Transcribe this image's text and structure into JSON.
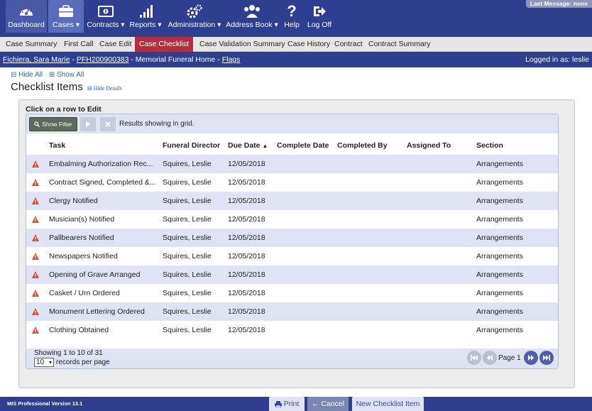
{
  "nav": {
    "items": [
      {
        "label": "Dashboard",
        "icon": "dashboard-icon"
      },
      {
        "label": "Cases",
        "icon": "briefcase-icon",
        "dropdown": true
      },
      {
        "label": "Contracts",
        "icon": "money-icon",
        "dropdown": true
      },
      {
        "label": "Reports",
        "icon": "bar-chart-icon",
        "dropdown": true
      },
      {
        "label": "Administration",
        "icon": "gears-icon",
        "dropdown": true
      },
      {
        "label": "Address Book",
        "icon": "users-icon",
        "dropdown": true
      },
      {
        "label": "Help",
        "icon": "question-icon"
      },
      {
        "label": "Log Off",
        "icon": "logout-icon"
      }
    ],
    "last_message": "Last Message: none"
  },
  "subtabs": [
    "Case Summary",
    "First Call",
    "Case Edit",
    "Case Checklist",
    "Case Validation Summary",
    "Case History",
    "Contract",
    "Contract Summary"
  ],
  "infobar": {
    "name": "Fichiera, Sara Marie",
    "sep1": " - ",
    "case_no": "PFH200900383",
    "sep2": " - Memorial Funeral Home - ",
    "flags": "Flags",
    "logged_in": "Logged in as: leslie"
  },
  "toggles": {
    "hide_all": "⊟ Hide All",
    "show_all": "⊞ Show All"
  },
  "page": {
    "title": "Checklist Items",
    "hide_details": "⊟ Hide Details",
    "caption": "Click on a row to Edit"
  },
  "toolbar": {
    "show_filter": "Show Filter",
    "results_text": "Results showing in grid."
  },
  "grid": {
    "columns": [
      "Task",
      "Funeral Director",
      "Due Date",
      "Complete Date",
      "Completed By",
      "Assigned To",
      "Section"
    ],
    "rows": [
      {
        "task": "Embalming Authorization Rec...",
        "director": "Squires, Leslie",
        "due": "12/05/2018",
        "complete": "",
        "completed_by": "",
        "assigned": "",
        "section": "Arrangements"
      },
      {
        "task": "Contract Signed, Completed &...",
        "director": "Squires, Leslie",
        "due": "12/05/2018",
        "complete": "",
        "completed_by": "",
        "assigned": "",
        "section": "Arrangements"
      },
      {
        "task": "Clergy Notified",
        "director": "Squires, Leslie",
        "due": "12/05/2018",
        "complete": "",
        "completed_by": "",
        "assigned": "",
        "section": "Arrangements"
      },
      {
        "task": "Musician(s) Notified",
        "director": "Squires, Leslie",
        "due": "12/05/2018",
        "complete": "",
        "completed_by": "",
        "assigned": "",
        "section": "Arrangements"
      },
      {
        "task": "Pallbearers Notified",
        "director": "Squires, Leslie",
        "due": "12/05/2018",
        "complete": "",
        "completed_by": "",
        "assigned": "",
        "section": "Arrangements"
      },
      {
        "task": "Newspapers Notified",
        "director": "Squires, Leslie",
        "due": "12/05/2018",
        "complete": "",
        "completed_by": "",
        "assigned": "",
        "section": "Arrangements"
      },
      {
        "task": "Opening of Grave Arranged",
        "director": "Squires, Leslie",
        "due": "12/05/2018",
        "complete": "",
        "completed_by": "",
        "assigned": "",
        "section": "Arrangements"
      },
      {
        "task": "Casket / Urn Ordered",
        "director": "Squires, Leslie",
        "due": "12/05/2018",
        "complete": "",
        "completed_by": "",
        "assigned": "",
        "section": "Arrangements"
      },
      {
        "task": "Monument Lettering Ordered",
        "director": "Squires, Leslie",
        "due": "12/05/2018",
        "complete": "",
        "completed_by": "",
        "assigned": "",
        "section": "Arrangements"
      },
      {
        "task": "Clothing Obtained",
        "director": "Squires, Leslie",
        "due": "12/05/2018",
        "complete": "",
        "completed_by": "",
        "assigned": "",
        "section": "Arrangements"
      }
    ],
    "sort_column": "Due Date",
    "sort_dir": "ascending"
  },
  "pagination": {
    "showing": "Showing 1 to 10 of 31",
    "per_page_value": "10",
    "per_page_label": "records per page",
    "page_label": "Page 1"
  },
  "footer": {
    "version": "MIS Professional Version 13.1",
    "print": "Print",
    "cancel": "Cancel",
    "new_item": "New Checklist Item"
  },
  "colors": {
    "nav_bg": "#2f3e8f",
    "active_tab": "#b03040",
    "row_alt": "#dfe3f3",
    "warning": "#e0482d"
  }
}
